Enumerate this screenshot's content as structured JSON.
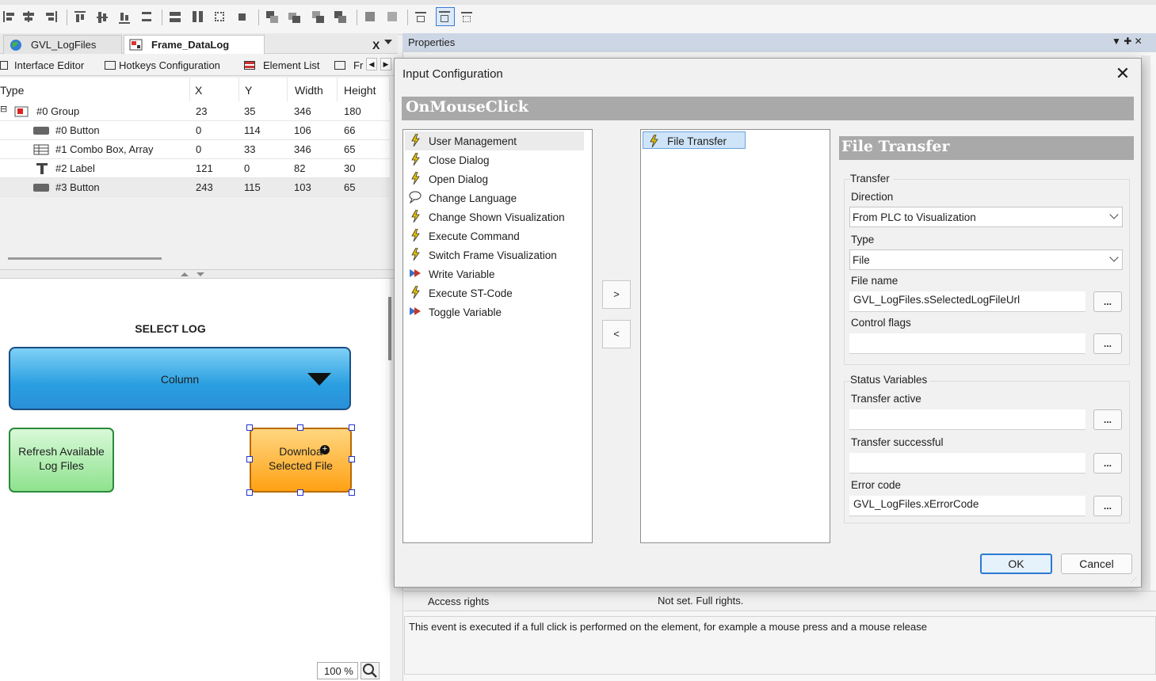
{
  "editor": {
    "tabs": [
      {
        "label": "GVL_LogFiles"
      },
      {
        "label": "Frame_DataLog",
        "active": true
      }
    ],
    "tab_close_glyph": "X",
    "sub_tabs": [
      "Interface Editor",
      "Hotkeys Configuration",
      "Element List",
      "Fr"
    ],
    "nav_prev": "◀",
    "nav_next": "▶",
    "element_list": {
      "columns": [
        "Type",
        "X",
        "Y",
        "Width",
        "Height"
      ],
      "rows": [
        {
          "expander": "⊟",
          "icon": "group-icon",
          "type": "#0 Group",
          "x": "23",
          "y": "35",
          "width": "346",
          "height": "180"
        },
        {
          "icon": "button-icon",
          "type": "#0 Button",
          "x": "0",
          "y": "114",
          "width": "106",
          "height": "66"
        },
        {
          "icon": "combo-box-icon",
          "type": "#1 Combo Box, Array",
          "x": "0",
          "y": "33",
          "width": "346",
          "height": "65"
        },
        {
          "icon": "label-icon",
          "type": "#2 Label",
          "x": "121",
          "y": "0",
          "width": "82",
          "height": "30"
        },
        {
          "icon": "button-icon",
          "type": "#3 Button",
          "x": "243",
          "y": "115",
          "width": "103",
          "height": "65",
          "selected": true
        }
      ]
    },
    "canvas": {
      "label_text": "SELECT LOG",
      "combo_text": "Column",
      "refresh_button_line1": "Refresh Available",
      "refresh_button_line2": "Log Files",
      "download_button_line1": "Downloa",
      "download_button_line2": "Selected File"
    },
    "zoom": "100 %"
  },
  "properties": {
    "title": "Properties",
    "header_controls": "▼  ✚  ✕",
    "access_rights_label": "Access rights",
    "access_rights_value": "Not set. Full rights.",
    "description": "This event is executed if a full click is performed on the element, for example a mouse press and a mouse release"
  },
  "dialog": {
    "title": "Input Configuration",
    "close_glyph": "✕",
    "event": "OnMouseClick",
    "available_actions": [
      {
        "label": "User Management",
        "icon": "lightning-icon",
        "selected": true
      },
      {
        "label": "Close Dialog",
        "icon": "lightning-icon"
      },
      {
        "label": "Open Dialog",
        "icon": "lightning-icon"
      },
      {
        "label": "Change Language",
        "icon": "speech-bubble-icon"
      },
      {
        "label": "Change Shown Visualization",
        "icon": "lightning-icon"
      },
      {
        "label": "Execute Command",
        "icon": "lightning-icon"
      },
      {
        "label": "Switch Frame Visualization",
        "icon": "lightning-icon"
      },
      {
        "label": "Write Variable",
        "icon": "write-variable-icon"
      },
      {
        "label": "Execute ST-Code",
        "icon": "lightning-icon"
      },
      {
        "label": "Toggle Variable",
        "icon": "write-variable-icon"
      }
    ],
    "add_button": ">",
    "remove_button": "<",
    "selected_actions": [
      {
        "label": "File Transfer",
        "icon": "lightning-icon"
      }
    ],
    "file_transfer": {
      "title": "File Transfer",
      "transfer_group": "Transfer",
      "direction_label": "Direction",
      "direction_value": "From PLC to Visualization",
      "type_label": "Type",
      "type_value": "File",
      "file_name_label": "File name",
      "file_name_value": "GVL_LogFiles.sSelectedLogFileUrl",
      "control_flags_label": "Control flags",
      "control_flags_value": "",
      "status_group": "Status Variables",
      "transfer_active_label": "Transfer active",
      "transfer_active_value": "",
      "transfer_successful_label": "Transfer successful",
      "transfer_successful_value": "",
      "error_code_label": "Error code",
      "error_code_value": "GVL_LogFiles.xErrorCode",
      "browse_label": "..."
    },
    "ok_label": "OK",
    "cancel_label": "Cancel"
  },
  "colors": {
    "accent": "#2b7ad3",
    "props_header": "#cdd6e4",
    "section_band": "#a9a9a9",
    "combo_blue": "#2a9fe1",
    "button_green": "#8ee28e",
    "button_orange": "#ffa114",
    "lightning": "#e8c200"
  }
}
